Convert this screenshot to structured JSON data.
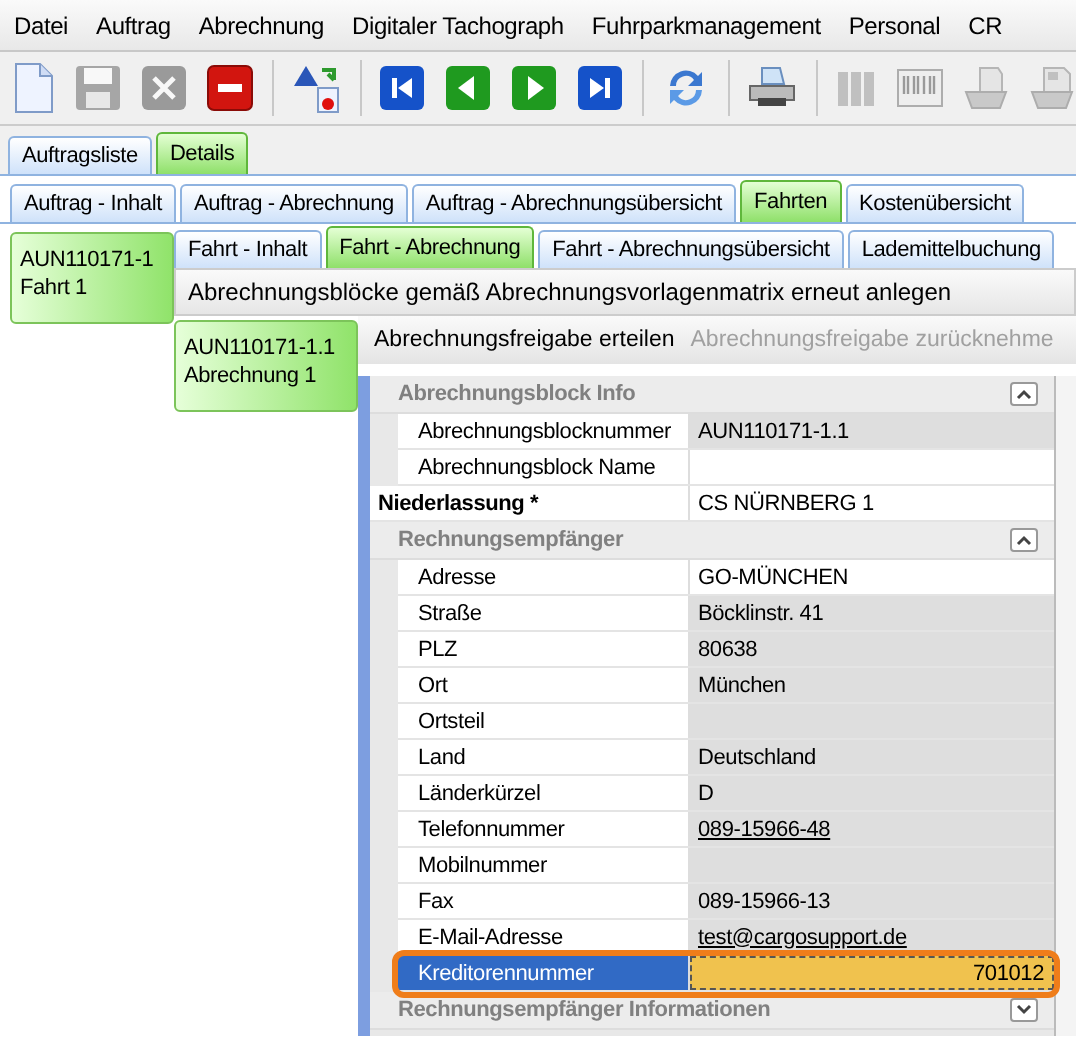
{
  "menu": [
    "Datei",
    "Auftrag",
    "Abrechnung",
    "Digitaler Tachograph",
    "Fuhrparkmanagement",
    "Personal",
    "CR"
  ],
  "toolbar": [
    {
      "kind": "new",
      "disabled": false
    },
    {
      "kind": "save",
      "disabled": true
    },
    {
      "kind": "cancel",
      "disabled": true
    },
    {
      "kind": "remove",
      "disabled": false
    },
    {
      "kind": "sep"
    },
    {
      "kind": "swap",
      "disabled": false
    },
    {
      "kind": "sep"
    },
    {
      "kind": "first",
      "disabled": false
    },
    {
      "kind": "prev",
      "disabled": false
    },
    {
      "kind": "next",
      "disabled": false
    },
    {
      "kind": "last",
      "disabled": false
    },
    {
      "kind": "sep"
    },
    {
      "kind": "refresh",
      "disabled": false
    },
    {
      "kind": "sep"
    },
    {
      "kind": "print",
      "disabled": false
    },
    {
      "kind": "sep"
    },
    {
      "kind": "binders",
      "disabled": true
    },
    {
      "kind": "barcode",
      "disabled": true
    },
    {
      "kind": "fax",
      "disabled": true
    },
    {
      "kind": "scan",
      "disabled": true
    }
  ],
  "main_tabs": [
    {
      "label": "Auftragsliste",
      "selected": false
    },
    {
      "label": "Details",
      "selected": true
    }
  ],
  "order_tabs": [
    {
      "label": "Auftrag - Inhalt",
      "selected": false
    },
    {
      "label": "Auftrag - Abrechnung",
      "selected": false
    },
    {
      "label": "Auftrag - Abrechnungsübersicht",
      "selected": false
    },
    {
      "label": "Fahrten",
      "selected": true
    },
    {
      "label": "Kostenübersicht",
      "selected": false
    }
  ],
  "trips": [
    {
      "lines": [
        "AUN110171-1",
        "Fahrt 1"
      ],
      "selected": true
    }
  ],
  "trip_tabs": [
    {
      "label": "Fahrt - Inhalt",
      "selected": false
    },
    {
      "label": "Fahrt - Abrechnung",
      "selected": true
    },
    {
      "label": "Fahrt - Abrechnungsübersicht",
      "selected": false
    },
    {
      "label": "Lademittelbuchung",
      "selected": false
    }
  ],
  "action_button": "Abrechnungsblöcke gemäß Abrechnungsvorlagenmatrix erneut anlegen",
  "blocks": [
    {
      "lines": [
        "AUN110171-1.1",
        "Abrechnung 1"
      ],
      "selected": true
    }
  ],
  "block_actions": [
    {
      "label": "Abrechnungsfreigabe erteilen",
      "disabled": false
    },
    {
      "label": "Abrechnungsfreigabe zurücknehme",
      "disabled": true
    }
  ],
  "property_grid": [
    {
      "kind": "category",
      "label": "Abrechnungsblock Info",
      "expanded": true
    },
    {
      "kind": "property",
      "label": "Abrechnungsblocknummer",
      "value": "AUN110171-1.1",
      "readonly": true
    },
    {
      "kind": "property",
      "label": "Abrechnungsblock Name",
      "readonly": false
    },
    {
      "kind": "required",
      "label": "Niederlassung *",
      "value": "CS NÜRNBERG 1",
      "readonly": false
    },
    {
      "kind": "category",
      "label": "Rechnungsempfänger",
      "expanded": true
    },
    {
      "kind": "property",
      "label": "Adresse",
      "value": "GO-MÜNCHEN",
      "readonly": false
    },
    {
      "kind": "property",
      "label": "Straße",
      "value": "Böcklinstr. 41",
      "readonly": true
    },
    {
      "kind": "property",
      "label": "PLZ",
      "value": "80638",
      "readonly": true
    },
    {
      "kind": "property",
      "label": "Ort",
      "value": "München",
      "readonly": true
    },
    {
      "kind": "property",
      "label": "Ortsteil",
      "readonly": true
    },
    {
      "kind": "property",
      "label": "Land",
      "value": "Deutschland",
      "readonly": true
    },
    {
      "kind": "property",
      "label": "Länderkürzel",
      "value": "D",
      "readonly": true
    },
    {
      "kind": "link",
      "label": "Telefonnummer",
      "value": "089-15966-48",
      "readonly": true
    },
    {
      "kind": "property",
      "label": "Mobilnummer",
      "readonly": true
    },
    {
      "kind": "property",
      "label": "Fax",
      "value": "089-15966-13",
      "readonly": true
    },
    {
      "kind": "link",
      "label": "E-Mail-Adresse",
      "value": "test@cargosupport.de",
      "readonly": true
    },
    {
      "kind": "property",
      "label": "Kreditorennummer",
      "value": "701012",
      "readonly": true,
      "selected": true
    },
    {
      "kind": "category",
      "label": "Rechnungsempfänger Informationen",
      "expanded": false
    }
  ]
}
